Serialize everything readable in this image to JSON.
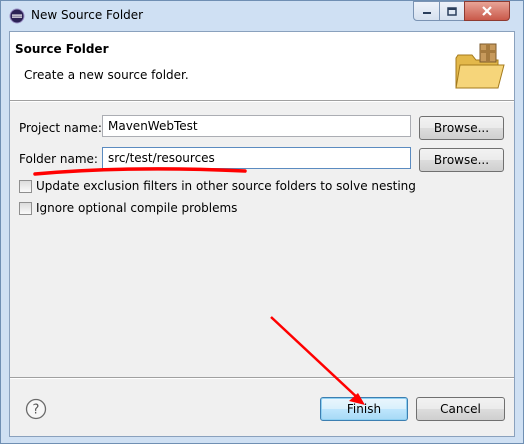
{
  "window": {
    "title": "New Source Folder",
    "icons": {
      "app": "eclipse-icon",
      "minimize": "minimize-icon",
      "maximize": "maximize-icon",
      "close": "close-icon"
    }
  },
  "header": {
    "title": "Source Folder",
    "description": "Create a new source folder.",
    "icon": "folder-package-icon"
  },
  "form": {
    "project_label": "Project name:",
    "project_value": "MavenWebTest",
    "folder_label": "Folder name:",
    "folder_value": "src/test/resources",
    "browse_label": "Browse...",
    "options": [
      {
        "label": "Update exclusion filters in other source folders to solve nesting",
        "checked": false
      },
      {
        "label": "Ignore optional compile problems",
        "checked": false
      }
    ]
  },
  "footer": {
    "help_icon": "help-icon",
    "finish_label": "Finish",
    "cancel_label": "Cancel"
  },
  "annotations": {
    "underline_color": "#ff0000",
    "arrow_color": "#ff0000"
  }
}
